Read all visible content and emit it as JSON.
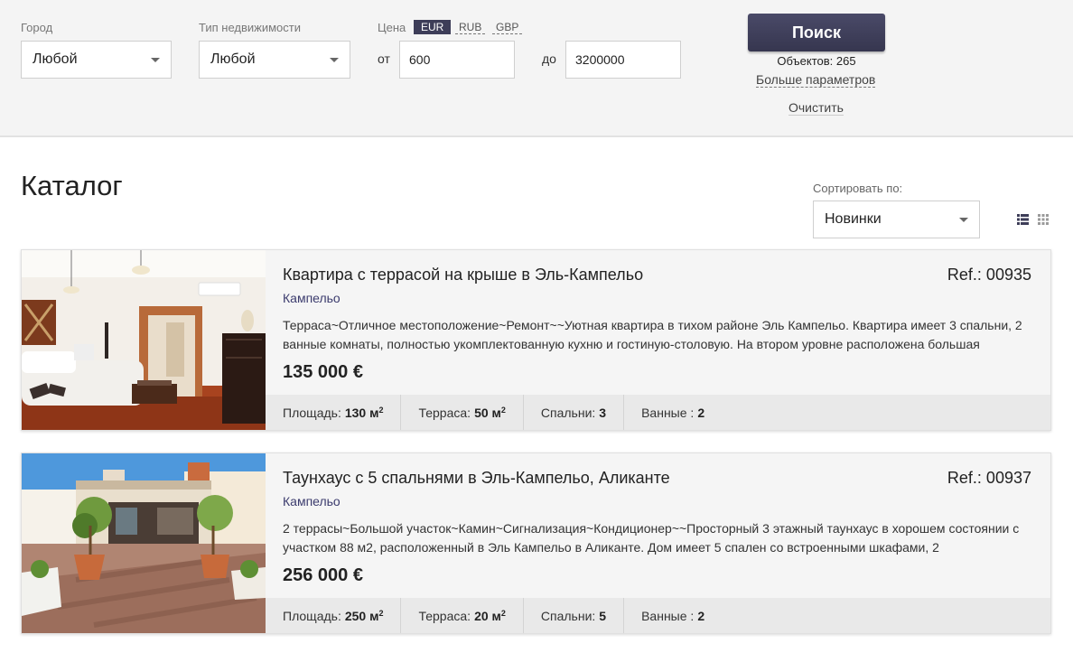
{
  "filters": {
    "city": {
      "label": "Город",
      "value": "Любой"
    },
    "property_type": {
      "label": "Тип недвижимости",
      "value": "Любой"
    },
    "price": {
      "label": "Цена",
      "currencies": [
        "EUR",
        "RUB",
        "GBP"
      ],
      "active_currency": "EUR",
      "from_label": "от",
      "to_label": "до",
      "from_value": "600",
      "to_value": "3200000"
    },
    "search_button": "Поиск",
    "objects_count": "Объектов: 265",
    "more_params": "Больше параметров",
    "clear": "Очистить"
  },
  "catalog": {
    "title": "Каталог",
    "sort_label": "Сортировать по:",
    "sort_value": "Новинки"
  },
  "listings": [
    {
      "title": "Квартира с террасой на крыше в Эль-Кампельо",
      "ref": "Ref.: 00935",
      "location": "Кампельо",
      "description": "Терраса~Отличное местоположение~Ремонт~~Уютная квартира в тихом районе Эль Кампельо. Квартира имеет 3 спальни, 2 ванные комнаты, полностью укомплектованную кухню и гостиную-столовую. На втором уровне расположена большая",
      "price": "135 000 €",
      "specs": {
        "area_label": "Площадь:",
        "area_value": "130 м",
        "terrace_label": "Терраса:",
        "terrace_value": "50 м",
        "bedrooms_label": "Спальни:",
        "bedrooms_value": "3",
        "bathrooms_label": "Ванные :",
        "bathrooms_value": "2",
        "unit_sup": "2"
      }
    },
    {
      "title": "Таунхаус с 5 спальнями в Эль-Кампельо, Аликанте",
      "ref": "Ref.: 00937",
      "location": "Кампельо",
      "description": "2 террасы~Большой участок~Камин~Сигнализация~Кондиционер~~Просторный 3 этажный таунхаус в хорошем состоянии с участком 88 м2, расположенный в Эль Кампельо в Аликанте. Дом имеет 5 спален со встроенными шкафами, 2",
      "price": "256 000 €",
      "specs": {
        "area_label": "Площадь:",
        "area_value": "250 м",
        "terrace_label": "Терраса:",
        "terrace_value": "20 м",
        "bedrooms_label": "Спальни:",
        "bedrooms_value": "5",
        "bathrooms_label": "Ванные :",
        "bathrooms_value": "2",
        "unit_sup": "2"
      }
    }
  ],
  "colors": {
    "accent": "#3d3d58",
    "location_link": "#3b3b6d",
    "filter_bg": "#f4f4f4",
    "card_bg": "#f5f5f5",
    "specs_bg": "#e9e9e9"
  },
  "icons": [
    "caret-down-icon",
    "list-view-icon",
    "grid-view-icon"
  ]
}
